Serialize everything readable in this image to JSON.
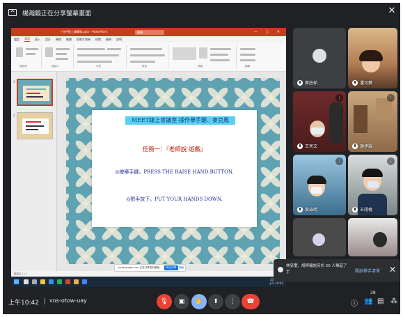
{
  "topbar": {
    "title": "楊瀚鍛正在分享螢幕畫面",
    "close_glyph": "✕"
  },
  "powerpoint": {
    "window_title": "三年甲班上課簡報.pptx - PowerPoint",
    "search_placeholder": "搜尋",
    "window_controls": "— ▢ ✕",
    "tabs": [
      "檔案",
      "常用",
      "插入",
      "設計",
      "轉場",
      "動畫",
      "投影片放映",
      "校閱",
      "檢視",
      "說明"
    ],
    "active_tab_index": 1,
    "ribbon_groups": [
      "剪貼簿",
      "投影片",
      "字型",
      "段落",
      "繪圖",
      "編輯"
    ],
    "status_text": "投影片 1 / 2",
    "slide_numbers": [
      "1",
      "2"
    ],
    "slide": {
      "heading": "MEET線上會議室-操作舉手鍵、麥克風",
      "task": "任務一：『老師說 遊戲』",
      "line1": "◎按舉手鍵。PRESS THE RAISE HAND BUTTON.",
      "line2": "◎把手放下。PUT YOUR HANDS DOWN."
    },
    "share_bar": {
      "text": "meet.google.com 正在分享您的畫面。",
      "stop_label": "停止分享",
      "hide_label": "隱藏"
    },
    "tray": {
      "weather": "33°C 多雲",
      "time": "上午 10:42",
      "date": "2021/5/26"
    }
  },
  "participants": [
    {
      "name": "黃莊茹",
      "color": "#3c4043"
    },
    {
      "name": "潘可蕎",
      "color": "#c28a5a"
    },
    {
      "name": "王亮文",
      "color": "#7a3b3b"
    },
    {
      "name": "謝伊霖",
      "color": "#8a6a4a"
    },
    {
      "name": "黃詠晴",
      "color": "#3b6e8e"
    },
    {
      "name": "王翊倫",
      "color": "#6c7a7a"
    },
    {
      "name": "",
      "color": "#4a4a4a"
    },
    {
      "name": "",
      "color": "#6a5a5a"
    }
  ],
  "toast": {
    "message": "林妥慶、胡婷羅說另外 20 人舉起了手",
    "link": "開啟舉手清單",
    "close_glyph": "✕"
  },
  "bottombar": {
    "time": "上午10:42",
    "meeting_code": "vos-otow-uay",
    "participant_count": "28"
  },
  "icons": {
    "mic_off": "mic-off-icon",
    "camera_off": "camera-off-icon",
    "raise_hand": "raise-hand-icon",
    "present": "present-now-icon",
    "more": "more-options-icon",
    "hangup": "hangup-icon",
    "info": "info-icon",
    "people": "people-icon",
    "chat": "chat-icon",
    "activities": "activities-icon"
  },
  "colors": {
    "meet_background": "#202124",
    "powerpoint_accent": "#c43e1c",
    "slide_background": "#5fa3b3",
    "hangup_red": "#ea4335",
    "raised_hand_blue": "#8ab4f8"
  }
}
